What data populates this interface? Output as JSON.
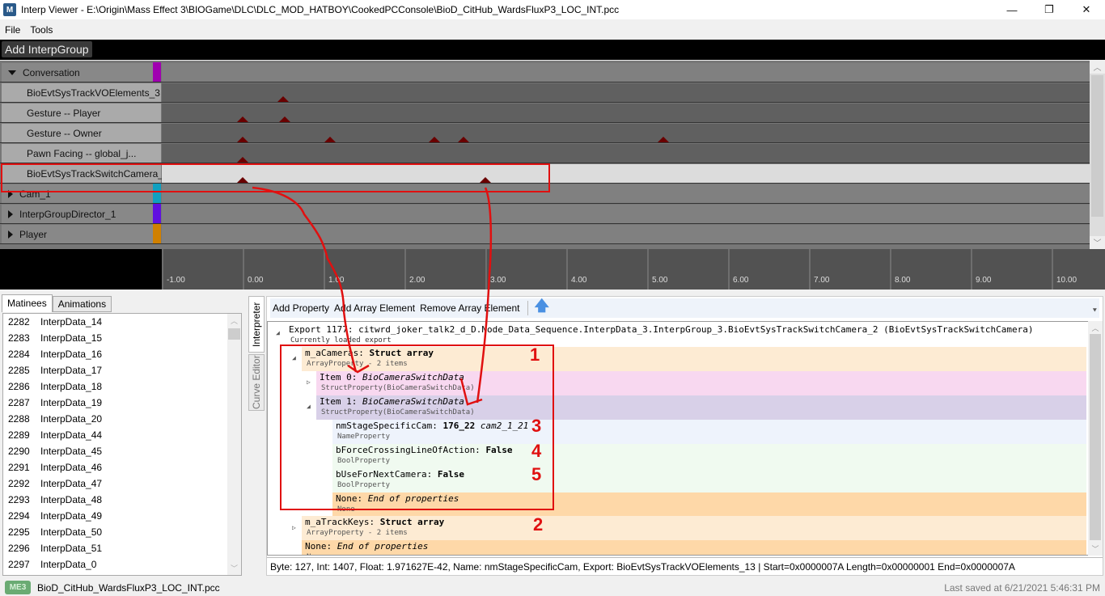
{
  "window": {
    "title": "Interp Viewer - E:\\Origin\\Mass Effect 3\\BIOGame\\DLC\\DLC_MOD_HATBOY\\CookedPCConsole\\BioD_CitHub_WardsFluxP3_LOC_INT.pcc",
    "app_icon": "M",
    "minimize": "—",
    "maximize": "❐",
    "close": "✕"
  },
  "menu": [
    "File",
    "Tools"
  ],
  "timeline": {
    "add_group_label": "Add InterpGroup",
    "groups": [
      {
        "label": "Conversation",
        "expanded": true,
        "color": "#a000b0",
        "tracks": [
          {
            "label": "BioEvtSysTrackVOElements_3",
            "keys": [
              0.5
            ]
          },
          {
            "label": "Gesture -- Player",
            "keys": [
              0.0,
              0.52
            ]
          },
          {
            "label": "Gesture -- Owner",
            "keys": [
              0.0,
              1.08,
              2.37,
              2.73,
              5.2
            ]
          },
          {
            "label": "Pawn Facing -- global_j...",
            "keys": [
              0.0
            ]
          },
          {
            "label": "BioEvtSysTrackSwitchCamera_2",
            "keys": [
              0.0,
              3.0
            ],
            "selected": true
          }
        ]
      },
      {
        "label": "Cam_1",
        "expanded": false,
        "color": "#10a0c0"
      },
      {
        "label": "InterpGroupDirector_1",
        "expanded": false,
        "color": "#6010e0"
      },
      {
        "label": "Player",
        "expanded": false,
        "color": "#d08000"
      }
    ],
    "ruler_ticks": [
      "-1.00",
      "0.00",
      "1.00",
      "2.00",
      "3.00",
      "4.00",
      "5.00",
      "6.00",
      "7.00",
      "8.00",
      "9.00",
      "10.00"
    ]
  },
  "left_panel": {
    "tabs": [
      "Matinees",
      "Animations"
    ],
    "active_tab": "Matinees",
    "items": [
      {
        "num": "2282",
        "name": "InterpData_14"
      },
      {
        "num": "2283",
        "name": "InterpData_15"
      },
      {
        "num": "2284",
        "name": "InterpData_16"
      },
      {
        "num": "2285",
        "name": "InterpData_17"
      },
      {
        "num": "2286",
        "name": "InterpData_18"
      },
      {
        "num": "2287",
        "name": "InterpData_19"
      },
      {
        "num": "2288",
        "name": "InterpData_20"
      },
      {
        "num": "2289",
        "name": "InterpData_44"
      },
      {
        "num": "2290",
        "name": "InterpData_45"
      },
      {
        "num": "2291",
        "name": "InterpData_46"
      },
      {
        "num": "2292",
        "name": "InterpData_47"
      },
      {
        "num": "2293",
        "name": "InterpData_48"
      },
      {
        "num": "2294",
        "name": "InterpData_49"
      },
      {
        "num": "2295",
        "name": "InterpData_50"
      },
      {
        "num": "2296",
        "name": "InterpData_51"
      },
      {
        "num": "2297",
        "name": "InterpData_0"
      }
    ]
  },
  "right_panel": {
    "vtabs": [
      "Interpreter",
      "Curve Editor"
    ],
    "toolbar": {
      "add_property": "Add Property",
      "add_array_element": "Add Array Element",
      "remove_array_element": "Remove Array Element",
      "up_icon": "🡅",
      "overflow_icon": "⯆"
    },
    "tree": {
      "export": {
        "l1": "Export 1177: citwrd_joker_talk2_d_D.Node_Data_Sequence.InterpData_3.InterpGroup_3.BioEvtSysTrackSwitchCamera_2 (BioEvtSysTrackSwitchCamera)",
        "l2": "Currently loaded export"
      },
      "m_aCameras": {
        "name": "m_aCameras: ",
        "value": "Struct array",
        "l2": "ArrayProperty - 2 items"
      },
      "item0": {
        "name": "Item 0: ",
        "value": "BioCameraSwitchData",
        "l2": "StructProperty(BioCameraSwitchData)"
      },
      "item1": {
        "name": "Item 1: ",
        "value": "BioCameraSwitchData",
        "l2": "StructProperty(BioCameraSwitchData)"
      },
      "nmStage": {
        "name": "nmStageSpecificCam: ",
        "value": "176_22",
        "extra": " cam2_1_21",
        "l2": "NameProperty"
      },
      "bForce": {
        "name": "bForceCrossingLineOfAction: ",
        "value": "False",
        "l2": "BoolProperty"
      },
      "bUse": {
        "name": "bUseForNextCamera: ",
        "value": "False",
        "l2": "BoolProperty"
      },
      "none_inner": {
        "name": "None: ",
        "value": "End of properties",
        "l2": "None"
      },
      "m_aTrackKeys": {
        "name": "m_aTrackKeys: ",
        "value": "Struct array",
        "l2": "ArrayProperty - 2 items"
      },
      "none_outer": {
        "name": "None: ",
        "value": "End of properties",
        "l2": "None"
      }
    },
    "status": "Byte: 127, Int: 1407, Float: 1.971627E-42, Name: nmStageSpecificCam, Export: BioEvtSysTrackVOElements_13 | Start=0x0000007A Length=0x00000001 End=0x0000007A"
  },
  "statusbar": {
    "badge": "ME3",
    "file": "BioD_CitHub_WardsFluxP3_LOC_INT.pcc",
    "saved": "Last saved at 6/21/2021 5:46:31 PM"
  },
  "annotations": {
    "labels": [
      "1",
      "2",
      "3",
      "4",
      "5"
    ],
    "color": "#e01010"
  }
}
